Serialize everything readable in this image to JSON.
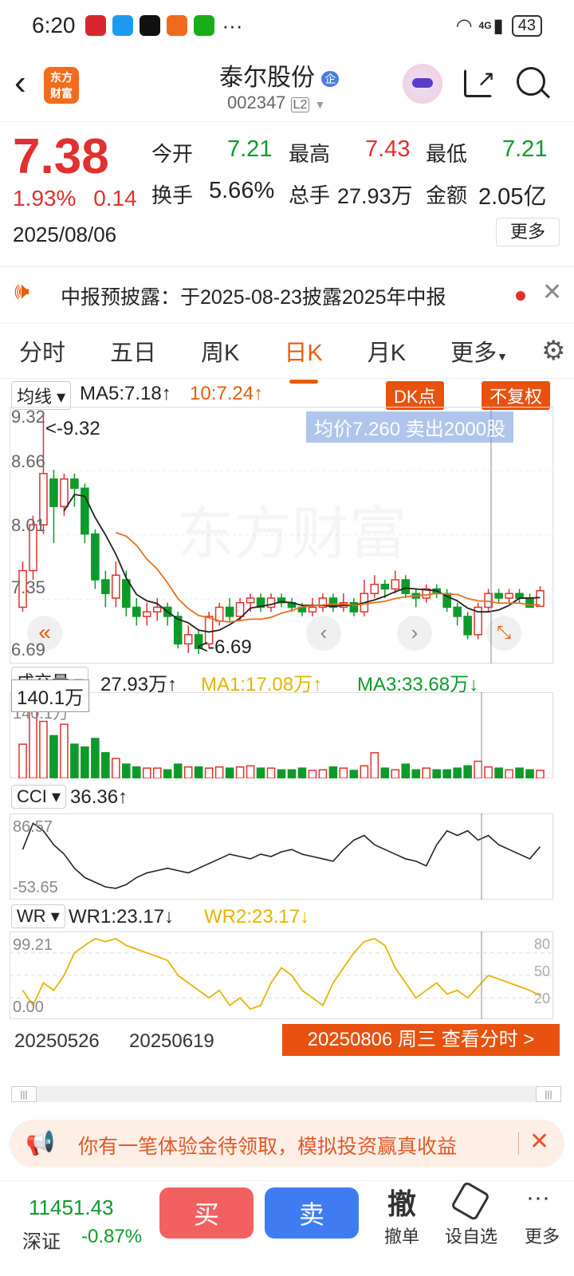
{
  "status": {
    "time": "6:20",
    "battery": "43",
    "dots": "···",
    "net": "4G"
  },
  "header": {
    "logo": "东方\n财富",
    "name": "泰尔股份",
    "badge": "企",
    "code": "002347",
    "level": "L2"
  },
  "quote": {
    "price": "7.38",
    "pct": "1.93%",
    "chg": "0.14",
    "date": "2025/08/06",
    "labels": {
      "open": "今开",
      "high": "最高",
      "low": "最低",
      "turn": "换手",
      "vol": "总手",
      "amt": "金额"
    },
    "open": "7.21",
    "high": "7.43",
    "low": "7.21",
    "turnover": "5.66%",
    "volume": "27.93万",
    "amount": "2.05亿",
    "more": "更多"
  },
  "notice": {
    "text": "中报预披露：于2025-08-23披露2025年中报"
  },
  "tabs": [
    "分时",
    "五日",
    "周K",
    "日K",
    "月K",
    "更多"
  ],
  "kline": {
    "ma_chip": "均线",
    "ma5": "MA5:7.18↑",
    "ma10": "10:7.24↑",
    "dk": "DK点",
    "fq": "不复权",
    "axis": [
      "9.32",
      "8.66",
      "8.01",
      "7.35",
      "6.69"
    ],
    "hi_label": "9.32",
    "lo_label": "6.69",
    "tip": "均价7.260  卖出2000股",
    "watermark": "东方财富"
  },
  "volume": {
    "chip": "成交量",
    "value": "27.93万↑",
    "ma1": "MA1:17.08万↑",
    "ma3": "MA3:33.68万↓",
    "max_box": "140.1万",
    "max_axis": "140.1万"
  },
  "cci": {
    "chip": "CCI",
    "value": "36.36↑",
    "axis_top": "86.57",
    "axis_bot": "-53.65"
  },
  "wr": {
    "chip": "WR",
    "wr1": "WR1:23.17↓",
    "wr2": "WR2:23.17↓",
    "axis_top": "99.21",
    "axis_bot": "0.00",
    "r80": "80",
    "r50": "50",
    "r20": "20"
  },
  "dates": {
    "d1": "20250526",
    "d2": "20250619",
    "detail": "20250806 周三 查看分时 >"
  },
  "banner": {
    "text": "你有一笔体验金待领取，模拟投资赢真收益"
  },
  "bottom": {
    "index_val": "11451.43",
    "index_name": "深证",
    "index_pct": "-0.87%",
    "buy": "买",
    "sell": "卖",
    "cancel_icon": "撤",
    "cancel": "撤单",
    "watch": "设自选",
    "more": "更多"
  },
  "chart_data": {
    "type": "candlestick",
    "ylim": [
      6.69,
      9.32
    ],
    "candles": [
      [
        7.2,
        7.6,
        7.7,
        7.15
      ],
      [
        7.6,
        8.1,
        8.2,
        7.5
      ],
      [
        8.1,
        8.66,
        9.32,
        8.0
      ],
      [
        8.6,
        8.3,
        8.7,
        7.9
      ],
      [
        8.3,
        8.6,
        8.66,
        8.2
      ],
      [
        8.6,
        8.5,
        8.66,
        8.3
      ],
      [
        8.5,
        8.0,
        8.55,
        7.9
      ],
      [
        8.0,
        7.5,
        8.05,
        7.4
      ],
      [
        7.5,
        7.35,
        7.6,
        7.2
      ],
      [
        7.3,
        7.55,
        7.7,
        7.2
      ],
      [
        7.5,
        7.2,
        7.6,
        7.1
      ],
      [
        7.2,
        7.1,
        7.3,
        7.0
      ],
      [
        7.1,
        7.15,
        7.25,
        7.0
      ],
      [
        7.15,
        7.2,
        7.3,
        7.05
      ],
      [
        7.2,
        7.1,
        7.25,
        7.0
      ],
      [
        7.1,
        6.8,
        7.15,
        6.75
      ],
      [
        6.8,
        6.9,
        7.0,
        6.7
      ],
      [
        6.9,
        6.75,
        6.95,
        6.69
      ],
      [
        6.8,
        7.1,
        7.15,
        6.75
      ],
      [
        7.05,
        7.2,
        7.25,
        7.0
      ],
      [
        7.2,
        7.1,
        7.3,
        7.05
      ],
      [
        7.1,
        7.25,
        7.3,
        7.05
      ],
      [
        7.25,
        7.3,
        7.35,
        7.15
      ],
      [
        7.3,
        7.2,
        7.35,
        7.15
      ],
      [
        7.2,
        7.3,
        7.35,
        7.15
      ],
      [
        7.3,
        7.25,
        7.35,
        7.2
      ],
      [
        7.25,
        7.2,
        7.3,
        7.15
      ],
      [
        7.2,
        7.15,
        7.25,
        7.1
      ],
      [
        7.15,
        7.2,
        7.3,
        7.1
      ],
      [
        7.2,
        7.3,
        7.35,
        7.15
      ],
      [
        7.3,
        7.2,
        7.35,
        7.15
      ],
      [
        7.2,
        7.25,
        7.35,
        7.15
      ],
      [
        7.25,
        7.15,
        7.3,
        7.1
      ],
      [
        7.15,
        7.35,
        7.5,
        7.1
      ],
      [
        7.35,
        7.45,
        7.55,
        7.3
      ],
      [
        7.45,
        7.4,
        7.5,
        7.3
      ],
      [
        7.4,
        7.5,
        7.6,
        7.35
      ],
      [
        7.5,
        7.35,
        7.55,
        7.3
      ],
      [
        7.35,
        7.3,
        7.4,
        7.2
      ],
      [
        7.3,
        7.4,
        7.45,
        7.25
      ],
      [
        7.4,
        7.35,
        7.45,
        7.3
      ],
      [
        7.35,
        7.2,
        7.4,
        7.15
      ],
      [
        7.2,
        7.1,
        7.25,
        7.0
      ],
      [
        7.1,
        6.9,
        7.15,
        6.85
      ],
      [
        6.9,
        7.2,
        7.25,
        6.85
      ],
      [
        7.2,
        7.35,
        7.4,
        7.15
      ],
      [
        7.35,
        7.3,
        7.4,
        7.25
      ],
      [
        7.3,
        7.35,
        7.4,
        7.25
      ],
      [
        7.35,
        7.3,
        7.4,
        7.25
      ],
      [
        7.3,
        7.2,
        7.35,
        7.2
      ],
      [
        7.21,
        7.38,
        7.43,
        7.21
      ]
    ],
    "volume": [
      60,
      140,
      100,
      75,
      95,
      60,
      55,
      70,
      45,
      35,
      25,
      20,
      18,
      18,
      15,
      25,
      20,
      20,
      18,
      20,
      18,
      20,
      22,
      18,
      18,
      15,
      15,
      18,
      14,
      15,
      20,
      18,
      14,
      22,
      45,
      18,
      15,
      25,
      15,
      18,
      15,
      15,
      18,
      22,
      30,
      20,
      18,
      15,
      18,
      15,
      14
    ],
    "cci": [
      30,
      86,
      70,
      40,
      20,
      -10,
      -30,
      -40,
      -50,
      -53,
      -45,
      -30,
      -20,
      -15,
      -10,
      -15,
      -20,
      -10,
      0,
      10,
      20,
      15,
      10,
      20,
      15,
      25,
      30,
      20,
      15,
      10,
      5,
      30,
      50,
      60,
      40,
      30,
      20,
      10,
      5,
      -5,
      40,
      70,
      60,
      70,
      50,
      60,
      40,
      30,
      20,
      10,
      36
    ],
    "wr1": [
      30,
      10,
      40,
      30,
      50,
      80,
      90,
      99,
      95,
      99,
      90,
      85,
      80,
      75,
      70,
      50,
      40,
      30,
      20,
      30,
      10,
      20,
      5,
      10,
      40,
      60,
      50,
      30,
      20,
      10,
      40,
      60,
      80,
      95,
      99,
      90,
      60,
      40,
      20,
      30,
      40,
      25,
      30,
      20,
      35,
      50,
      45,
      40,
      35,
      30,
      23
    ]
  }
}
